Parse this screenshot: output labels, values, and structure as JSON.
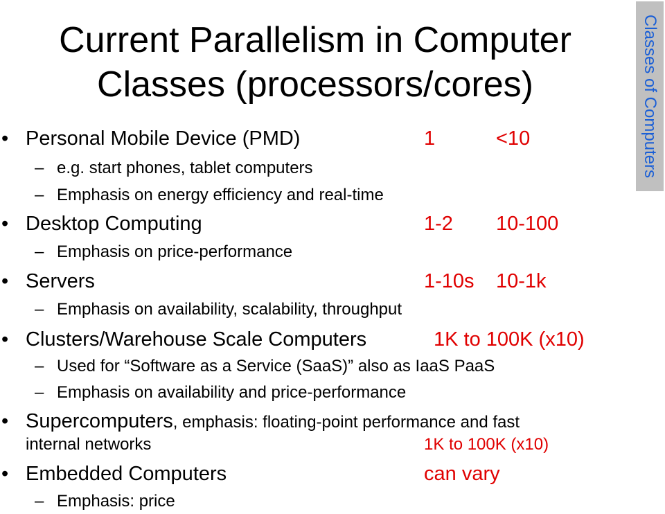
{
  "slide": {
    "title_line1": "Current Parallelism in Computer",
    "title_line2": "Classes (processors/cores)",
    "side_tab": "Classes of Computers",
    "bullet_glyph": "•",
    "dash_glyph": "–",
    "items": [
      {
        "label": "Personal Mobile Device (PMD)",
        "processors": "1",
        "cores": "<10",
        "subitems": [
          "e.g. start phones, tablet computers",
          "Emphasis on energy efficiency and real-time"
        ]
      },
      {
        "label": "Desktop Computing",
        "processors": "1-2",
        "cores": "10-100",
        "subitems": [
          "Emphasis on price-performance"
        ]
      },
      {
        "label": "Servers",
        "processors": "1-10s",
        "cores": "10-1k",
        "subitems": [
          "Emphasis on availability, scalability, throughput"
        ]
      },
      {
        "label": "Clusters/Warehouse Scale Computers",
        "range": "1K to 100K  (x10)",
        "subitems": [
          "Used for “Software as a Service (SaaS)” also as IaaS PaaS",
          "Emphasis on availability and price-performance"
        ]
      },
      {
        "label": "Supercomputers",
        "label_suffix": ", emphasis:  floating-point performance and fast",
        "continuation": "internal networks",
        "range": "1K to 100K  (x10)"
      },
      {
        "label": "Embedded Computers",
        "range": "can vary",
        "subitems": [
          "Emphasis:  price"
        ]
      }
    ]
  }
}
